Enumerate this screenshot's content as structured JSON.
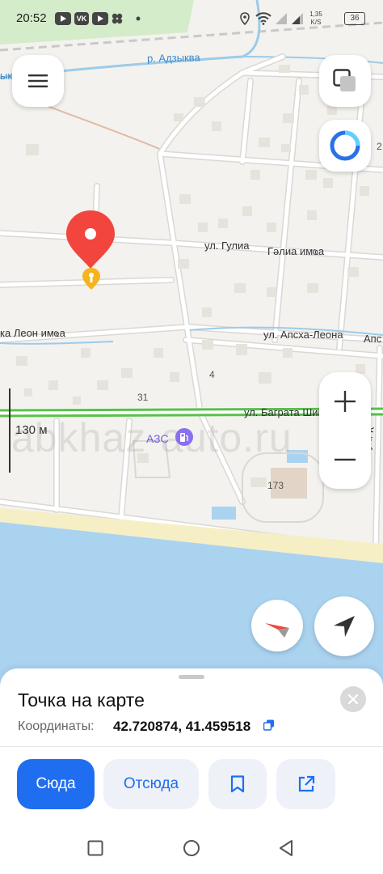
{
  "status_bar": {
    "time": "20:52",
    "speed_value": "1,35",
    "speed_unit": "K/S",
    "battery": "36"
  },
  "map": {
    "labels": {
      "river": "р. Адзыква",
      "river_left": "ык",
      "street_gulia": "ул. Гулиа",
      "street_gulia_abkh": "Гәлиа имҩа",
      "street_leon_abkh": "ка Леон имҩа",
      "street_apsha_leona": "ул. Апсха-Леона",
      "street_apsha_cut": "Апс",
      "street_bagrata": "ул. Баграта Шинкуба",
      "street_right_cut": "ул. К",
      "number_4": "4",
      "number_31": "31",
      "number_173": "173",
      "number_2": "2",
      "gas_station": "АЗС",
      "scale": "130 м",
      "watermark": "abkhaz-auto.ru"
    }
  },
  "colors": {
    "accent": "#1f6ef0",
    "pin": "#f2453d",
    "water": "#aad3f0",
    "traffic_green": "#58c14a",
    "gas_purple": "#8a6ff0"
  },
  "sheet": {
    "title": "Точка на карте",
    "coords_label": "Координаты:",
    "coords_value": "42.720874, 41.459518",
    "btn_here": "Сюда",
    "btn_from": "Отсюда"
  },
  "icons": [
    "menu-icon",
    "layers-icon",
    "alice-icon",
    "zoom-in-icon",
    "zoom-out-icon",
    "compass-icon",
    "locate-icon",
    "close-icon",
    "copy-icon",
    "bookmark-icon",
    "share-icon",
    "gas-station-icon",
    "pin-icon"
  ]
}
